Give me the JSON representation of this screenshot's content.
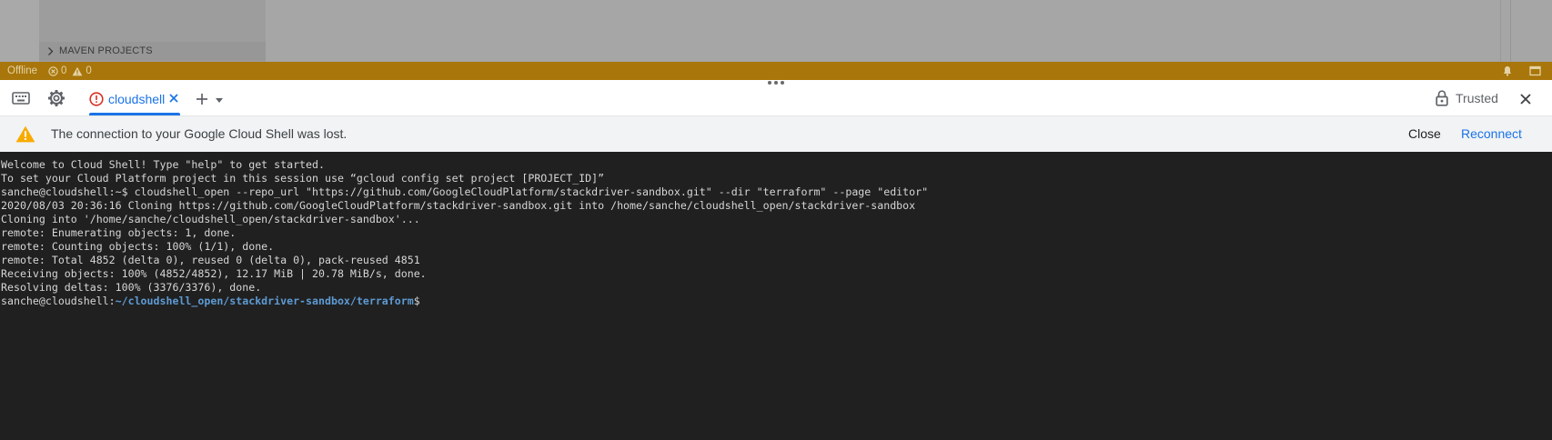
{
  "editor": {
    "maven_projects_label": "MAVEN PROJECTS"
  },
  "status_bar": {
    "offline_label": "Offline",
    "error_count": "0",
    "warning_count": "0",
    "background_color": "#a8760a"
  },
  "shell_toolbar": {
    "tab_label": "cloudshell",
    "trusted_label": "Trusted",
    "accent_color": "#1a73e8",
    "icons": [
      "keyboard-icon",
      "gear-icon",
      "error-icon",
      "close-icon",
      "plus-icon",
      "chevron-down-icon",
      "lock-icon",
      "close-icon"
    ]
  },
  "banner": {
    "message": "The connection to your Google Cloud Shell was lost.",
    "close_label": "Close",
    "reconnect_label": "Reconnect",
    "icon": "warning-icon"
  },
  "terminal": {
    "lines": [
      "Welcome to Cloud Shell! Type \"help\" to get started.",
      "To set your Cloud Platform project in this session use “gcloud config set project [PROJECT_ID]”",
      "sanche@cloudshell:~$ cloudshell_open --repo_url \"https://github.com/GoogleCloudPlatform/stackdriver-sandbox.git\" --dir \"terraform\" --page \"editor\"",
      "2020/08/03 20:36:16 Cloning https://github.com/GoogleCloudPlatform/stackdriver-sandbox.git into /home/sanche/cloudshell_open/stackdriver-sandbox",
      "Cloning into '/home/sanche/cloudshell_open/stackdriver-sandbox'...",
      "remote: Enumerating objects: 1, done.",
      "remote: Counting objects: 100% (1/1), done.",
      "remote: Total 4852 (delta 0), reused 0 (delta 0), pack-reused 4851",
      "Receiving objects: 100% (4852/4852), 12.17 MiB | 20.78 MiB/s, done.",
      "Resolving deltas: 100% (3376/3376), done."
    ],
    "prompt_user": "sanche@cloudshell:",
    "prompt_path": "~/cloudshell_open/stackdriver-sandbox/terraform",
    "prompt_suffix": "$"
  }
}
